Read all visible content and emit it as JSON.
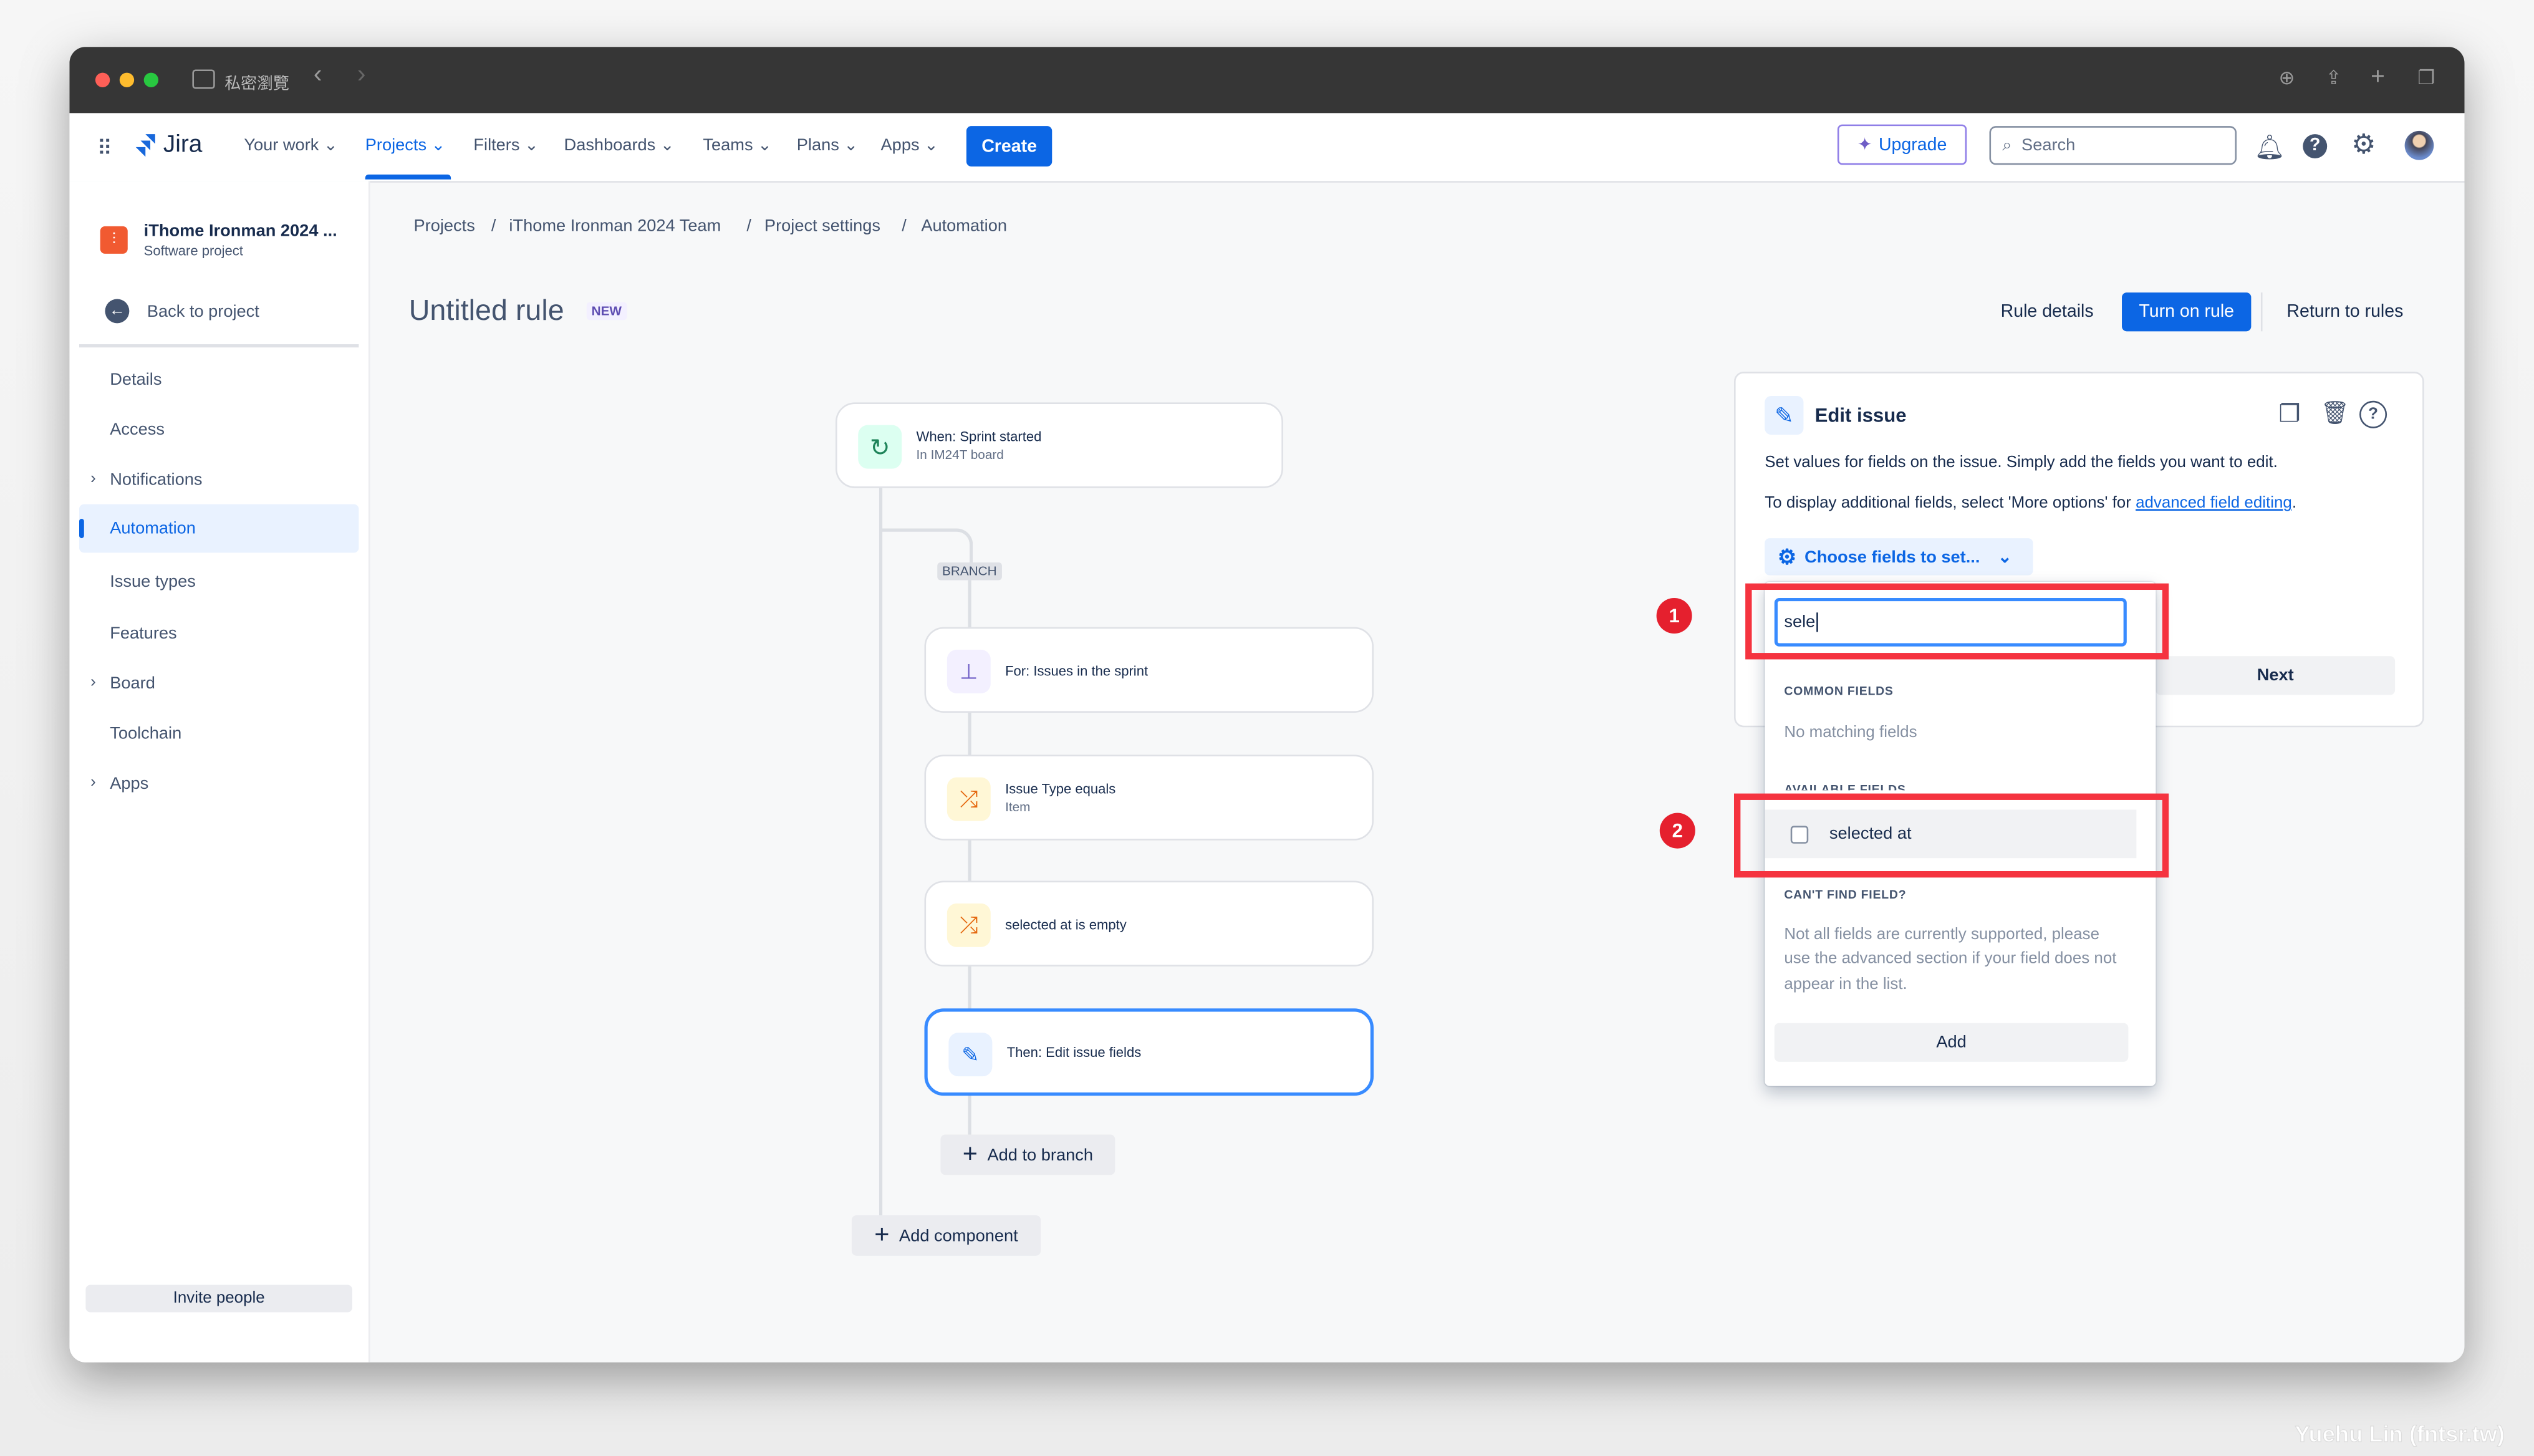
{
  "browser": {
    "private_label": "私密瀏覽",
    "back": "‹",
    "forward": "›"
  },
  "nav": {
    "logo": "Jira",
    "items": [
      {
        "label": "Your work"
      },
      {
        "label": "Projects"
      },
      {
        "label": "Filters"
      },
      {
        "label": "Dashboards"
      },
      {
        "label": "Teams"
      },
      {
        "label": "Plans"
      },
      {
        "label": "Apps"
      }
    ],
    "active": "Projects",
    "create": "Create",
    "upgrade": "Upgrade",
    "search_placeholder": "Search"
  },
  "sidebar": {
    "project_name": "iThome Ironman 2024 ...",
    "project_type": "Software project",
    "back": "Back to project",
    "items": [
      {
        "label": "Details"
      },
      {
        "label": "Access"
      },
      {
        "label": "Notifications"
      },
      {
        "label": "Automation"
      },
      {
        "label": "Issue types"
      },
      {
        "label": "Features"
      },
      {
        "label": "Board"
      },
      {
        "label": "Toolchain"
      },
      {
        "label": "Apps"
      }
    ],
    "active": "Automation",
    "invite": "Invite people"
  },
  "breadcrumb": [
    "Projects",
    "iThome Ironman 2024 Team",
    "Project settings",
    "Automation"
  ],
  "rule": {
    "title": "Untitled rule",
    "badge": "NEW",
    "rule_details": "Rule details",
    "turn_on": "Turn on rule",
    "return": "Return to rules"
  },
  "flow": {
    "trigger": {
      "title": "When: Sprint started",
      "subtitle": "In IM24T board"
    },
    "branch_label": "BRANCH",
    "branch_items": [
      {
        "title": "For: Issues in the sprint",
        "subtitle": ""
      },
      {
        "title": "Issue Type equals",
        "subtitle": "Item"
      },
      {
        "title": "selected at is empty",
        "subtitle": ""
      },
      {
        "title": "Then: Edit issue fields",
        "subtitle": ""
      }
    ],
    "add_to_branch": "Add to branch",
    "add_component": "Add component"
  },
  "panel": {
    "title": "Edit issue",
    "desc1": "Set values for fields on the issue. Simply add the fields you want to edit.",
    "desc2_prefix": "To display additional fields, select 'More options' for ",
    "desc2_link": "advanced field editing",
    "desc2_suffix": ".",
    "choose": "Choose fields to set...",
    "next": "Next"
  },
  "dropdown": {
    "search_value": "sele",
    "common_header": "COMMON FIELDS",
    "no_match": "No matching fields",
    "available_header": "AVAILABLE FIELDS",
    "option": "selected at",
    "option_checked": false,
    "cant_find": "CAN'T FIND FIELD?",
    "cant_find_desc": "Not all fields are currently supported, please use the advanced section if your field does not appear in the list.",
    "add": "Add"
  },
  "annotations": [
    "1",
    "2"
  ],
  "watermark": "Yuehu Lin (fntsr.tw)",
  "colors": {
    "primary": "#0c66e4",
    "annotation_red": "#f5333f",
    "trigger_green": "#1f845a",
    "branch_purple": "#6e5dc6",
    "condition_orange": "#e56910"
  }
}
